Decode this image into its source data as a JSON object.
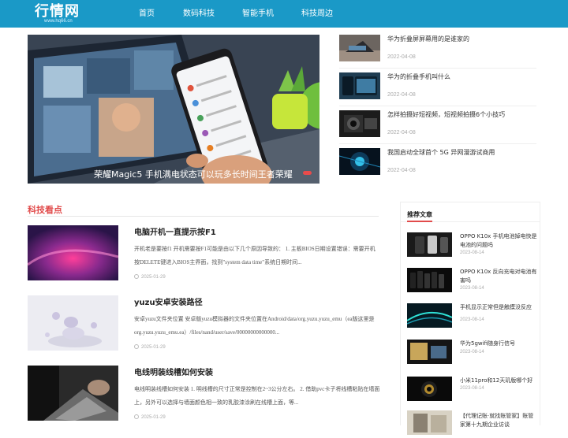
{
  "header": {
    "logo_main": "行情网",
    "logo_sub": "www.hq66.cn",
    "nav": [
      "首页",
      "数码科技",
      "智能手机",
      "科技周边"
    ]
  },
  "slider": {
    "caption": "荣耀Magic5 手机满电状态可以玩多长时间王者荣耀"
  },
  "side_news": [
    {
      "title": "华为折叠屏屏幕用的是谁家的",
      "date": "2022-04-08"
    },
    {
      "title": "华为的折叠手机叫什么",
      "date": "2022-04-08"
    },
    {
      "title": "怎样拍摄好短视频，短视频拍摄6个小技巧",
      "date": "2022-04-08"
    },
    {
      "title": "我国启动全球首个 5G 异网漫游试商用",
      "date": "2022-04-08"
    }
  ],
  "section": {
    "title": "科技看点"
  },
  "articles": [
    {
      "title": "电脑开机一直提示按F1",
      "desc": "开机老是要按f1 开机需要按F1可能是由以下几个原因导致的： 1. 主板BIOS日期设置错误：需要开机按DELETE键进入BIOS主界面，找到\"system data time\"系统日期时间...",
      "date": "2025-01-29"
    },
    {
      "title": "yuzu安卓安装路径",
      "desc": "安卓yuzu文件夹位置 安卓版yuzu模拟器的文件夹位置在Android/data/org.yuzu.yuzu_emu（ea版这里是org.yuzu.yuzu_emu.ea）/files/nand/user/save/00000000000000...",
      "date": "2025-01-29"
    },
    {
      "title": "电线明装线槽如何安装",
      "desc": "电线明装线槽如何安装 1. 明线槽的尺寸正常是控制在2~3公分左右。 2. 借助pvc卡子将线槽粘贴在墙面上，另外可以选择与墙面颜色相一致的乳胶漆涂刷在线槽上面，等...",
      "date": "2025-01-29"
    }
  ],
  "recommend": {
    "title": "推荐文章",
    "items": [
      {
        "title": "OPPO K10x 手机电池掉电快是电池的问题吗",
        "date": "2023-08-14"
      },
      {
        "title": "OPPO K10x 反向充电对电池有害吗",
        "date": "2023-08-14"
      },
      {
        "title": "手机显示正常但是触摸没反应",
        "date": "2023-08-14"
      },
      {
        "title": "华为5gwifi随身行信号",
        "date": "2023-08-14"
      },
      {
        "title": "小米11pro和12天玑版哪个好",
        "date": "2023-08-14"
      },
      {
        "title": "【代理记账·就找账管家】账管家第十九期企业访谈",
        "date": ""
      }
    ]
  }
}
